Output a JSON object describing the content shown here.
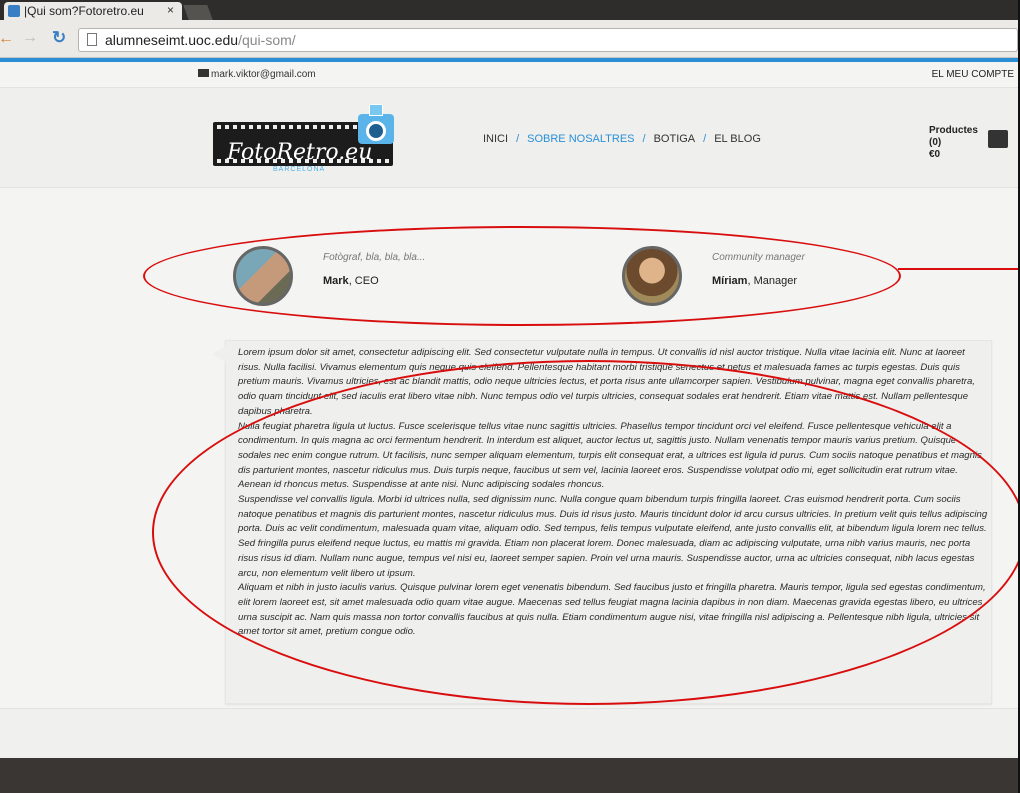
{
  "browser": {
    "tab_title": "|Qui som?Fotoretro.eu",
    "tab_close": "×",
    "url_domain": "alumneseimt.uoc.edu",
    "url_path": "/qui-som/"
  },
  "topbar": {
    "email": "mark.viktor@gmail.com",
    "account": "EL MEU COMPTE"
  },
  "logo": {
    "name": "FotoRetro.eu",
    "sub": "BARCELONA"
  },
  "nav": {
    "items": [
      "INICI",
      "SOBRE NOSALTRES",
      "BOTIGA",
      "EL BLOG"
    ],
    "separator": "/",
    "active": "SOBRE NOSALTRES"
  },
  "cart": {
    "label": "Productes",
    "count": "(0)",
    "total": "€0"
  },
  "team": [
    {
      "role": "Fotògraf, bla, bla, bla...",
      "name": "Mark",
      "title": ", CEO"
    },
    {
      "role": "Community manager",
      "name": "Míriam",
      "title": ", Manager"
    }
  ],
  "paragraphs": [
    "Lorem ipsum dolor sit amet, consectetur adipiscing elit. Sed consectetur vulputate nulla in tempus. Ut convallis id nisl auctor tristique. Nulla vitae lacinia elit. Nunc at laoreet risus. Nulla facilisi. Vivamus elementum quis neque quis eleifend. Pellentesque habitant morbi tristique senectus et netus et malesuada fames ac turpis egestas. Duis quis pretium mauris. Vivamus ultricies, est ac blandit mattis, odio neque ultricies lectus, et porta risus ante ullamcorper sapien. Vestibulum pulvinar, magna eget convallis pharetra, odio quam tincidunt elit, sed iaculis erat libero vitae nibh. Nunc tempus odio vel turpis ultricies, consequat sodales erat hendrerit. Etiam vitae mattis est. Nullam pellentesque dapibus pharetra.",
    "Nulla feugiat pharetra ligula ut luctus. Fusce scelerisque tellus vitae nunc sagittis ultricies. Phasellus tempor tincidunt orci vel eleifend. Fusce pellentesque vehicula elit a condimentum. In quis magna ac orci fermentum hendrerit. In interdum est aliquet, auctor lectus ut, sagittis justo. Nullam venenatis tempor mauris varius pretium. Quisque sodales nec enim congue rutrum. Ut facilisis, nunc semper aliquam elementum, turpis elit consequat erat, a ultrices est ligula id purus. Cum sociis natoque penatibus et magnis dis parturient montes, nascetur ridiculus mus. Duis turpis neque, faucibus ut sem vel, lacinia laoreet eros. Suspendisse volutpat odio mi, eget sollicitudin erat rutrum vitae. Aenean id rhoncus metus. Suspendisse at ante nisi. Nunc adipiscing sodales rhoncus.",
    "Suspendisse vel convallis ligula. Morbi id ultrices nulla, sed dignissim nunc. Nulla congue quam bibendum turpis fringilla laoreet. Cras euismod hendrerit porta. Cum sociis natoque penatibus et magnis dis parturient montes, nascetur ridiculus mus. Duis id risus justo. Mauris tincidunt dolor id arcu cursus ultricies. In pretium velit quis tellus adipiscing porta. Duis ac velit condimentum, malesuada quam vitae, aliquam odio. Sed tempus, felis tempus vulputate eleifend, ante justo convallis elit, at bibendum ligula lorem nec tellus. Sed fringilla purus eleifend neque luctus, eu mattis mi gravida. Etiam non placerat lorem. Donec malesuada, diam ac adipiscing vulputate, urna nibh varius mauris, nec porta risus risus id diam. Nullam nunc augue, tempus vel nisi eu, laoreet semper sapien. Proin vel urna mauris. Suspendisse auctor, urna ac ultricies consequat, nibh lacus egestas arcu, non elementum velit libero ut ipsum.",
    "Aliquam et nibh in justo iaculis varius. Quisque pulvinar lorem eget venenatis bibendum. Sed faucibus justo et fringilla pharetra. Mauris tempor, ligula sed egestas condimentum, elit lorem laoreet est, sit amet malesuada odio quam vitae augue. Maecenas sed tellus feugiat magna lacinia dapibus in non diam. Maecenas gravida egestas libero, eu ultrices urna suscipit ac. Nam quis massa non tortor convallis faucibus at quis nulla. Etiam condimentum augue nisi, vitae fringilla nisl adipiscing a. Pellentesque nibh ligula, ultricies sit amet tortor sit amet, pretium congue odio."
  ],
  "colors": {
    "accent": "#2a8fd6",
    "annotation": "#d80e0e",
    "footer": "#3a3633"
  }
}
